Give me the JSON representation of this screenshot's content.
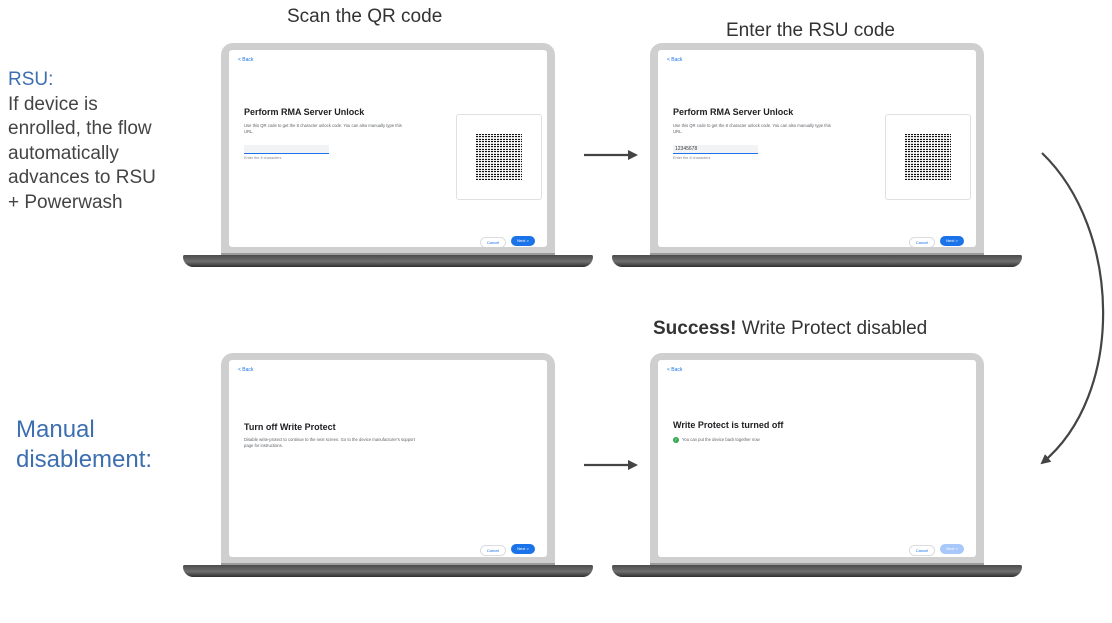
{
  "captions": {
    "scan_qr": "Scan the QR code",
    "enter_rsu": "Enter the RSU code",
    "success_bold": "Success!",
    "success_rest": " Write Protect disabled"
  },
  "rsu_note": {
    "heading": "RSU:",
    "lines": [
      "If device is",
      "enrolled, the flow",
      "automatically",
      "advances to RSU",
      "+ Powerwash"
    ]
  },
  "manual_note": {
    "lines": [
      "Manual",
      "disablement:"
    ]
  },
  "screens": {
    "scan": {
      "back": "< Back",
      "title": "Perform RMA Server Unlock",
      "description": "Use this QR code to get the 8 character unlock code. You can also manually type this URL.",
      "input_value": "",
      "hint": "Enter the 8 characters",
      "cancel": "Cancel",
      "next": "Next  >"
    },
    "enter": {
      "back": "< Back",
      "title": "Perform RMA Server Unlock",
      "description": "Use this QR code to get the 8 character unlock code. You can also manually type this URL.",
      "input_value": "12345678",
      "hint": "Enter the 8 characters",
      "cancel": "Cancel",
      "next": "Next  >"
    },
    "manual": {
      "back": "< Back",
      "title": "Turn off Write Protect",
      "description": "Disable write-protect to continue to the next screen. Go to the device manufacturer's support page for instructions.",
      "cancel": "Cancel",
      "next": "Next  >"
    },
    "success": {
      "back": "< Back",
      "title": "Write Protect is turned off",
      "status": "You can put the device back together now",
      "cancel": "Cancel",
      "next": "Next  >"
    }
  },
  "colors": {
    "accent": "#1a73e8",
    "note_blue": "#3d6fb0",
    "arrow": "#444444"
  }
}
